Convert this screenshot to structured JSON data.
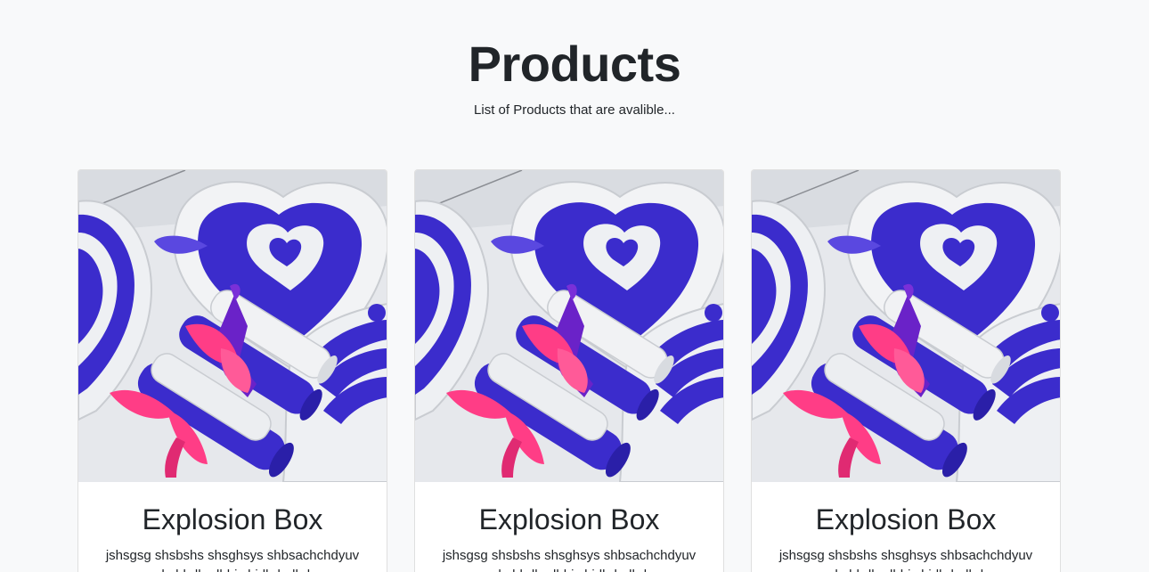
{
  "header": {
    "title": "Products",
    "subtitle": "List of Products that are avalible..."
  },
  "products": [
    {
      "image": "explosion-box-photo",
      "title": "Explosion Box",
      "description": "jshsgsg shsbshs shsghsys shbsachchdyuv shshbdhsdbhjs hjdbdgdhd"
    },
    {
      "image": "explosion-box-photo",
      "title": "Explosion Box",
      "description": "jshsgsg shsbshs shsghsys shbsachchdyuv shshbdhsdbhjs hjdbdgdhd"
    },
    {
      "image": "explosion-box-photo",
      "title": "Explosion Box",
      "description": "jshsgsg shsbshs shsghsys shbsachchdyuv shshbdhsdbhjs hjdbdgdhd"
    }
  ],
  "colors": {
    "page_bg": "#f8f9fa",
    "card_bg": "#ffffff",
    "text": "#212529",
    "paper_blue": "#3b2ccc",
    "ribbon_pink": "#ff3d86",
    "ribbon_purple": "#6a22c8",
    "paper_white": "#eef0f3"
  }
}
